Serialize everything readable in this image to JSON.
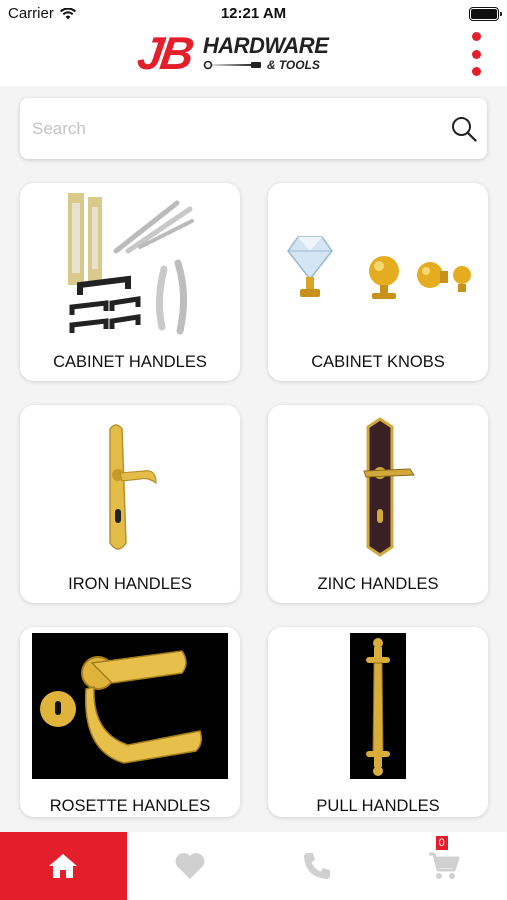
{
  "status_bar": {
    "carrier": "Carrier",
    "time": "12:21 AM"
  },
  "header": {
    "logo": {
      "mark": "JB",
      "line1": "HARDWARE",
      "line2": "& TOOLS"
    }
  },
  "search": {
    "placeholder": "Search",
    "value": ""
  },
  "categories": [
    {
      "label": "CABINET HANDLES",
      "icon": "cabinet-handles-image"
    },
    {
      "label": "CABINET KNOBS",
      "icon": "cabinet-knobs-image"
    },
    {
      "label": "IRON HANDLES",
      "icon": "iron-handle-image"
    },
    {
      "label": "ZINC HANDLES",
      "icon": "zinc-handle-image"
    },
    {
      "label": "ROSETTE HANDLES",
      "icon": "rosette-handle-image"
    },
    {
      "label": "PULL HANDLES",
      "icon": "pull-handle-image"
    }
  ],
  "tab_bar": {
    "tabs": [
      {
        "name": "home",
        "icon": "home-icon",
        "active": true
      },
      {
        "name": "favorites",
        "icon": "heart-icon",
        "active": false
      },
      {
        "name": "call",
        "icon": "phone-icon",
        "active": false
      },
      {
        "name": "cart",
        "icon": "cart-icon",
        "active": false
      }
    ],
    "cart_count": "0"
  },
  "colors": {
    "brand": "#e41e2b",
    "background": "#f4f4f4",
    "inactive_icon": "#d0d0d0"
  }
}
